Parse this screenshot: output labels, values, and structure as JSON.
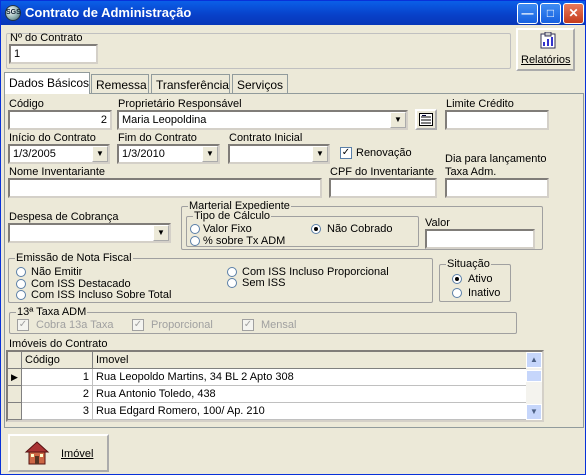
{
  "window": {
    "title": "Contrato de Administração",
    "icon_text": "SGS"
  },
  "header": {
    "contract_no_label": "Nº do Contrato",
    "contract_no_value": "1",
    "reports_label": "Relatórios"
  },
  "tabs": [
    {
      "label": "Dados Básicos",
      "active": true
    },
    {
      "label": "Remessa"
    },
    {
      "label": "Transferência"
    },
    {
      "label": "Serviços"
    }
  ],
  "form": {
    "codigo_label": "Código",
    "codigo_value": "2",
    "proprietario_label": "Proprietário Responsável",
    "proprietario_value": "Maria Leopoldina",
    "limite_label": "Limite Crédito",
    "limite_value": "",
    "inicio_label": "Início do Contrato",
    "inicio_value": "1/3/2005",
    "fim_label": "Fim do Contrato",
    "fim_value": "1/3/2010",
    "inicial_label": "Contrato Inicial",
    "inicial_value": "",
    "renovacao_label": "Renovação",
    "renovacao_checked": true,
    "dia_label_1": "Dia para lançamento",
    "dia_label_2": "Taxa Adm.",
    "dia_value": "",
    "inventariante_label": "Nome Inventariante",
    "inventariante_value": "",
    "cpf_label": "CPF do Inventariante",
    "cpf_value": "",
    "despesa_label": "Despesa de Cobrança",
    "despesa_value": "",
    "expediente_title": "Marterial Expediente",
    "calculo_title": "Tipo de Cálculo",
    "calc_valor_fixo": "Valor Fixo",
    "calc_percent": "% sobre Tx ADM",
    "calc_nao_cobrado": "Não Cobrado",
    "calc_selected": "Não Cobrado",
    "valor_label": "Valor",
    "valor_value": "",
    "nf_title": "Emissão de Nota Fiscal",
    "nf_options": [
      "Não Emitir",
      "Com ISS Destacado",
      "Com ISS Incluso Sobre Total",
      "Com ISS Incluso Proporcional",
      "Sem ISS"
    ],
    "situacao_title": "Situação",
    "sit_ativo": "Ativo",
    "sit_inativo": "Inativo",
    "sit_selected": "Ativo",
    "taxa13_title": "13ª Taxa ADM",
    "taxa13_cobra": "Cobra 13a Taxa",
    "taxa13_proporcional": "Proporcional",
    "taxa13_mensal": "Mensal"
  },
  "imoveis": {
    "title": "Imóveis do Contrato",
    "columns": [
      "Código",
      "Imovel"
    ],
    "rows": [
      {
        "codigo": "1",
        "imovel": "Rua Leopoldo Martins, 34 BL 2 Apto 308",
        "current": true
      },
      {
        "codigo": "2",
        "imovel": "Rua Antonio Toledo, 438"
      },
      {
        "codigo": "3",
        "imovel": "Rua Edgard Romero, 100/ Ap. 210"
      }
    ]
  },
  "footer": {
    "imovel_button": "Imóvel"
  },
  "colors": {
    "titlebar": "#0a5fe8",
    "face": "#ece9d8"
  }
}
